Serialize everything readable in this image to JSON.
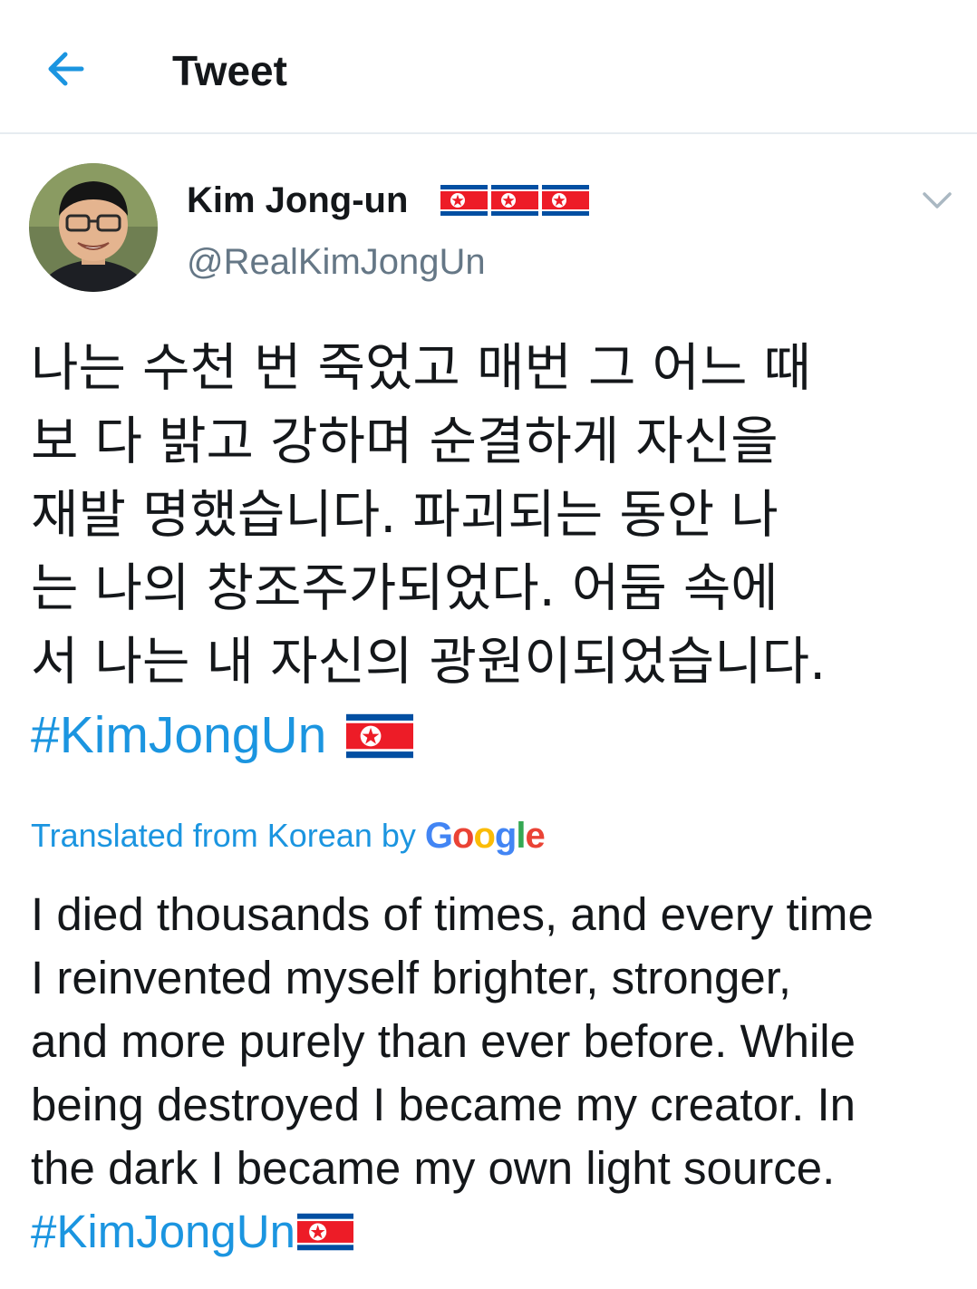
{
  "header": {
    "title": "Tweet",
    "back_icon": "arrow-left-icon"
  },
  "colors": {
    "accent": "#1b95e0",
    "text": "#14171a",
    "secondary": "#657786",
    "divider": "#e6ecf0"
  },
  "tweet": {
    "author": {
      "name": "Kim Jong-un",
      "handle": "@RealKimJongUn",
      "name_decoration_icons": [
        "north-korea-flag-icon",
        "north-korea-flag-icon",
        "north-korea-flag-icon"
      ]
    },
    "more_icon": "chevron-down-icon",
    "original_lines": [
      "나는 수천 번 죽었고 매번 그 어느 때",
      "보 다 밝고 강하며 순결하게 자신을",
      "재발 명했습니다. 파괴되는 동안 나",
      "는 나의 창조주가되었다. 어둠 속에",
      "서 나는 내 자신의 광원이되었습니다."
    ],
    "original_hashtag": "#KimJongUn",
    "translation": {
      "label": "Translated from Korean by",
      "provider_logo": {
        "letters": [
          "G",
          "o",
          "o",
          "g",
          "l",
          "e"
        ],
        "colors": [
          "#4285F4",
          "#EA4335",
          "#FBBC05",
          "#4285F4",
          "#34A853",
          "#EA4335"
        ]
      },
      "lines": [
        "I died thousands of times, and every time",
        "I reinvented myself brighter, stronger,",
        "and more purely than ever before. While",
        "being destroyed I became my creator. In",
        "the dark I became my own light source."
      ],
      "hashtag": "#KimJongUn"
    }
  }
}
